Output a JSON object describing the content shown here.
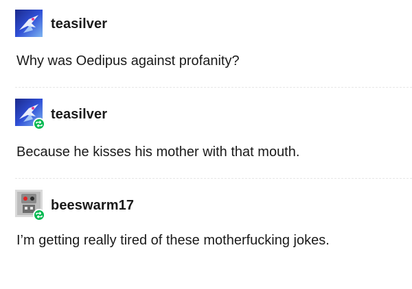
{
  "posts": [
    {
      "username": "teasilver",
      "text": "Why was Oedipus against profanity?",
      "avatar_icon": "hummingbird-avatar-icon",
      "reblog": false
    },
    {
      "username": "teasilver",
      "text": "Because he kisses his mother with that mouth.",
      "avatar_icon": "hummingbird-avatar-icon",
      "reblog": true
    },
    {
      "username": "beeswarm17",
      "text": "I’m getting really tired of these motherfucking jokes.",
      "avatar_icon": "robot-avatar-icon",
      "reblog": true
    }
  ],
  "colors": {
    "reblog_badge": "#00b84f",
    "text": "#1a1a1a",
    "divider": "#e6e6e6"
  }
}
